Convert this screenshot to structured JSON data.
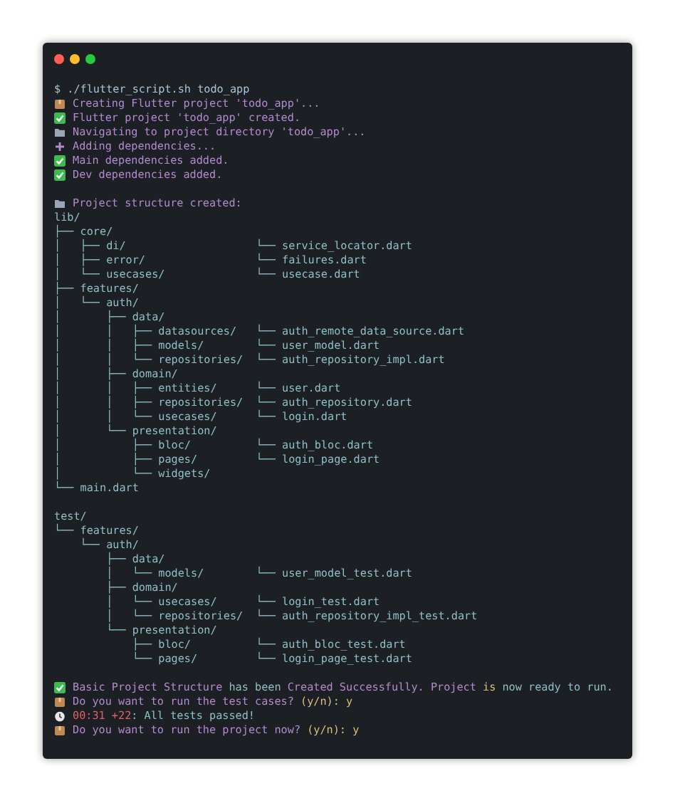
{
  "window": {
    "controls": [
      {
        "kind": "close"
      },
      {
        "kind": "minimize"
      },
      {
        "kind": "maximize"
      }
    ]
  },
  "lines": [
    {
      "kind": "prompt",
      "segments": [
        {
          "kind": "prompt",
          "text": "$ ./flutter_script.sh todo_app"
        }
      ]
    },
    {
      "kind": "package",
      "segments": [
        {
          "kind": "accent",
          "text": "Creating Flutter project 'todo_app'..."
        }
      ]
    },
    {
      "kind": "check",
      "segments": [
        {
          "kind": "accent",
          "text": "Flutter project 'todo_app' created."
        }
      ]
    },
    {
      "kind": "folder",
      "segments": [
        {
          "kind": "accent",
          "text": "Navigating to project directory 'todo_app'..."
        }
      ]
    },
    {
      "kind": "plus",
      "segments": [
        {
          "kind": "accent",
          "text": "Adding dependencies..."
        }
      ]
    },
    {
      "kind": "check",
      "segments": [
        {
          "kind": "accent",
          "text": "Main dependencies added."
        }
      ]
    },
    {
      "kind": "check",
      "segments": [
        {
          "kind": "accent",
          "text": "Dev dependencies added."
        }
      ]
    },
    {
      "kind": "blank"
    },
    {
      "kind": "folder",
      "segments": [
        {
          "kind": "accent",
          "text": "Project structure created:"
        }
      ]
    },
    {
      "kind": "tree",
      "tree": "lib/"
    },
    {
      "kind": "tree",
      "tree": "├── core/"
    },
    {
      "kind": "tree",
      "tree": "│   ├── di/",
      "file": "└── service_locator.dart"
    },
    {
      "kind": "tree",
      "tree": "│   ├── error/",
      "file": "└── failures.dart"
    },
    {
      "kind": "tree",
      "tree": "│   └── usecases/",
      "file": "└── usecase.dart"
    },
    {
      "kind": "tree",
      "tree": "├── features/"
    },
    {
      "kind": "tree",
      "tree": "│   └── auth/"
    },
    {
      "kind": "tree",
      "tree": "│       ├── data/"
    },
    {
      "kind": "tree",
      "tree": "│       │   ├── datasources/",
      "file": "└── auth_remote_data_source.dart"
    },
    {
      "kind": "tree",
      "tree": "│       │   ├── models/",
      "file": "└── user_model.dart"
    },
    {
      "kind": "tree",
      "tree": "│       │   └── repositories/",
      "file": "└── auth_repository_impl.dart"
    },
    {
      "kind": "tree",
      "tree": "│       ├── domain/"
    },
    {
      "kind": "tree",
      "tree": "│       │   ├── entities/",
      "file": "└── user.dart"
    },
    {
      "kind": "tree",
      "tree": "│       │   ├── repositories/",
      "file": "└── auth_repository.dart"
    },
    {
      "kind": "tree",
      "tree": "│       │   └── usecases/",
      "file": "└── login.dart"
    },
    {
      "kind": "tree",
      "tree": "│       └── presentation/"
    },
    {
      "kind": "tree",
      "tree": "│           ├── bloc/",
      "file": "└── auth_bloc.dart"
    },
    {
      "kind": "tree",
      "tree": "│           ├── pages/",
      "file": "└── login_page.dart"
    },
    {
      "kind": "tree",
      "tree": "│           └── widgets/"
    },
    {
      "kind": "tree",
      "tree": "└── main.dart"
    },
    {
      "kind": "blank"
    },
    {
      "kind": "tree",
      "tree": "test/"
    },
    {
      "kind": "tree",
      "tree": "└── features/"
    },
    {
      "kind": "tree",
      "tree": "    └── auth/"
    },
    {
      "kind": "tree",
      "tree": "        ├── data/"
    },
    {
      "kind": "tree",
      "tree": "        │   └── models/",
      "file": "└── user_model_test.dart"
    },
    {
      "kind": "tree",
      "tree": "        ├── domain/"
    },
    {
      "kind": "tree",
      "tree": "        │   └── usecases/",
      "file": "└── login_test.dart"
    },
    {
      "kind": "tree",
      "tree": "        │   └── repositories/",
      "file": "└── auth_repository_impl_test.dart"
    },
    {
      "kind": "tree",
      "tree": "        └── presentation/"
    },
    {
      "kind": "tree",
      "tree": "            ├── bloc/",
      "file": "└── auth_bloc_test.dart"
    },
    {
      "kind": "tree",
      "tree": "            └── pages/",
      "file": "└── login_page_test.dart"
    },
    {
      "kind": "blank"
    },
    {
      "kind": "check",
      "segments": [
        {
          "kind": "accent",
          "text": "Basic Project Structure"
        },
        {
          "kind": "plain",
          "text": "has been"
        },
        {
          "kind": "accent",
          "text": "Created Successfully."
        },
        {
          "kind": "accent",
          "text": "Project"
        },
        {
          "kind": "yellow",
          "text": "is"
        },
        {
          "kind": "plain",
          "text": "now ready to run."
        }
      ]
    },
    {
      "kind": "package",
      "segments": [
        {
          "kind": "accent",
          "text": "Do you want to run the test cases?"
        },
        {
          "kind": "yellow",
          "text": "(y/n): y"
        }
      ]
    },
    {
      "kind": "timer",
      "segments": [
        {
          "kind": "red",
          "text": "00:31"
        },
        {
          "kind": "red",
          "text": "+22"
        },
        {
          "kind": "plain",
          "text": ": All tests passed!",
          "join": true
        }
      ]
    },
    {
      "kind": "package",
      "segments": [
        {
          "kind": "accent",
          "text": "Do you want to run the project now?"
        },
        {
          "kind": "yellow",
          "text": "(y/n): y"
        }
      ]
    }
  ]
}
